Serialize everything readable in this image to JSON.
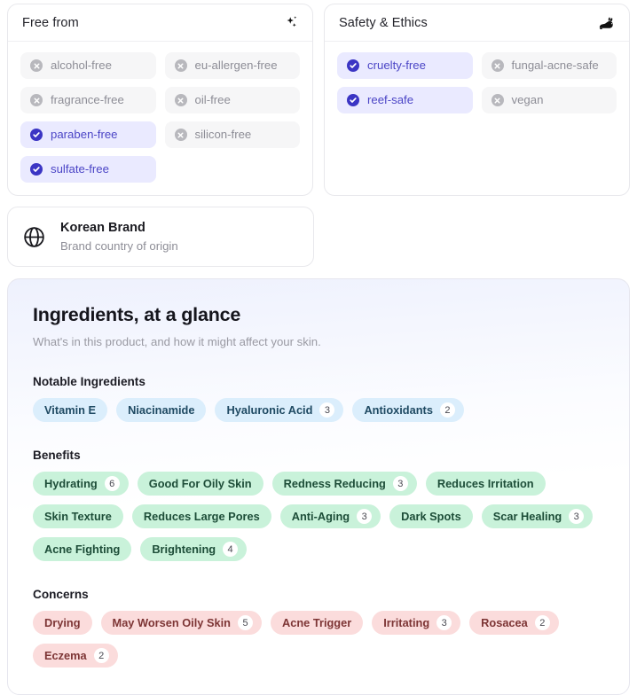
{
  "free_from": {
    "title": "Free from",
    "icon": "sparkles-icon",
    "items": [
      {
        "label": "alcohol-free",
        "state": "off",
        "icon": "x-circle-icon"
      },
      {
        "label": "eu-allergen-free",
        "state": "off",
        "icon": "x-circle-icon"
      },
      {
        "label": "fragrance-free",
        "state": "off",
        "icon": "x-circle-icon"
      },
      {
        "label": "oil-free",
        "state": "off",
        "icon": "x-circle-icon"
      },
      {
        "label": "paraben-free",
        "state": "on",
        "icon": "check-circle-icon"
      },
      {
        "label": "silicon-free",
        "state": "off",
        "icon": "x-circle-icon"
      },
      {
        "label": "sulfate-free",
        "state": "on",
        "icon": "check-circle-icon"
      }
    ]
  },
  "safety_ethics": {
    "title": "Safety & Ethics",
    "icon": "rabbit-icon",
    "items": [
      {
        "label": "cruelty-free",
        "state": "on",
        "icon": "check-circle-icon"
      },
      {
        "label": "fungal-acne-safe",
        "state": "off",
        "icon": "x-circle-icon"
      },
      {
        "label": "reef-safe",
        "state": "on",
        "icon": "check-circle-icon"
      },
      {
        "label": "vegan",
        "state": "off",
        "icon": "x-circle-icon"
      }
    ]
  },
  "brand": {
    "icon": "globe-icon",
    "title": "Korean Brand",
    "subtitle": "Brand country of origin"
  },
  "glance": {
    "title": "Ingredients, at a glance",
    "subtitle": "What's in this product, and how it might affect your skin.",
    "sections": [
      {
        "label": "Notable Ingredients",
        "tone": "blue",
        "tags": [
          {
            "label": "Vitamin E",
            "count": null
          },
          {
            "label": "Niacinamide",
            "count": null
          },
          {
            "label": "Hyaluronic Acid",
            "count": "3"
          },
          {
            "label": "Antioxidants",
            "count": "2"
          }
        ]
      },
      {
        "label": "Benefits",
        "tone": "green",
        "tags": [
          {
            "label": "Hydrating",
            "count": "6"
          },
          {
            "label": "Good For Oily Skin",
            "count": null
          },
          {
            "label": "Redness Reducing",
            "count": "3"
          },
          {
            "label": "Reduces Irritation",
            "count": null
          },
          {
            "label": "Skin Texture",
            "count": null
          },
          {
            "label": "Reduces Large Pores",
            "count": null
          },
          {
            "label": "Anti-Aging",
            "count": "3"
          },
          {
            "label": "Dark Spots",
            "count": null
          },
          {
            "label": "Scar Healing",
            "count": "3"
          },
          {
            "label": "Acne Fighting",
            "count": null
          },
          {
            "label": "Brightening",
            "count": "4"
          }
        ]
      },
      {
        "label": "Concerns",
        "tone": "red",
        "tags": [
          {
            "label": "Drying",
            "count": null
          },
          {
            "label": "May Worsen Oily Skin",
            "count": "5"
          },
          {
            "label": "Acne Trigger",
            "count": null
          },
          {
            "label": "Irritating",
            "count": "3"
          },
          {
            "label": "Rosacea",
            "count": "2"
          },
          {
            "label": "Eczema",
            "count": "2"
          }
        ]
      }
    ]
  },
  "colors": {
    "accent_indigo": "#3b35c4",
    "chip_on_bg": "#eaeaff",
    "chip_off_bg": "#f6f6f7",
    "tag_blue_bg": "#dbeefc",
    "tag_green_bg": "#c9f2da",
    "tag_red_bg": "#fbdcdc"
  }
}
